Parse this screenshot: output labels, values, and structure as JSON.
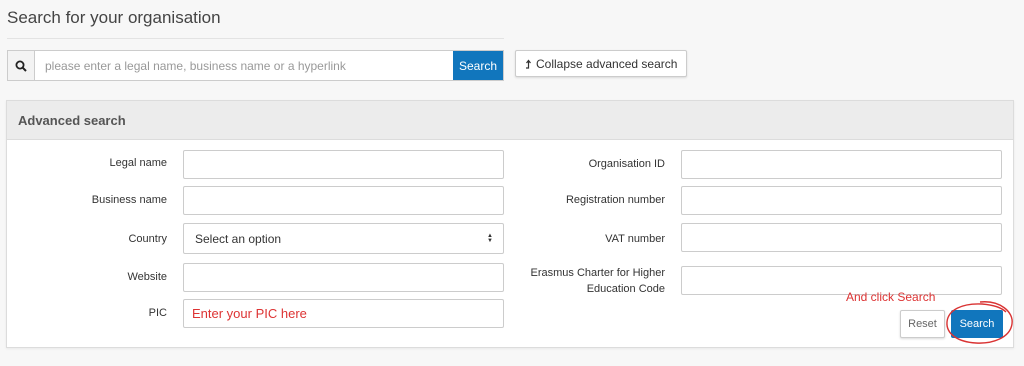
{
  "page": {
    "title": "Search for your organisation"
  },
  "search": {
    "placeholder": "please enter a legal name, business name or a hyperlink",
    "button_label": "Search",
    "icon": "search-icon"
  },
  "collapse_button": {
    "label": "Collapse advanced search",
    "icon": "arrow-up-icon"
  },
  "advanced": {
    "title": "Advanced search",
    "left_fields": [
      {
        "label": "Legal name",
        "value": ""
      },
      {
        "label": "Business name",
        "value": ""
      },
      {
        "label": "Country",
        "value": "Select an option"
      },
      {
        "label": "Website",
        "value": ""
      },
      {
        "label": "PIC",
        "value": ""
      }
    ],
    "right_fields": [
      {
        "label": "Organisation ID",
        "value": ""
      },
      {
        "label": "Registration number",
        "value": ""
      },
      {
        "label": "VAT number",
        "value": ""
      },
      {
        "label": "Erasmus Charter for Higher Education Code",
        "value": ""
      }
    ],
    "reset_label": "Reset",
    "search_label": "Search"
  },
  "annotations": {
    "pic_hint": "Enter your PIC here",
    "click_hint": "And click Search",
    "color": "#d93333"
  },
  "colors": {
    "primary": "#1176bd",
    "panel_header": "#ececec",
    "background": "#f7f7f7"
  }
}
